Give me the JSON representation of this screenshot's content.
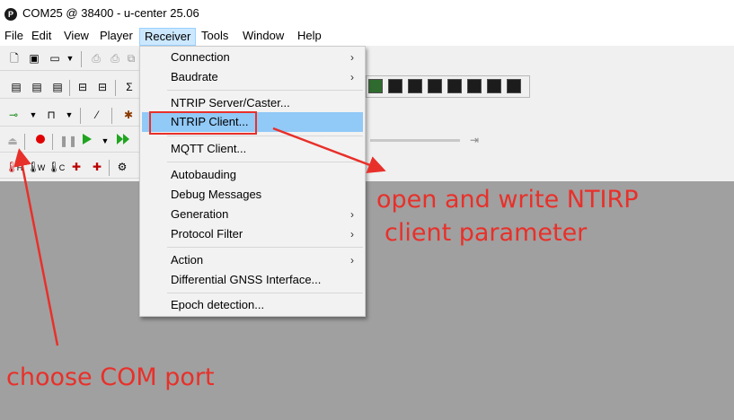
{
  "window": {
    "title": "COM25 @ 38400 - u-center 25.06",
    "logo_letter": "P"
  },
  "menubar": {
    "items": [
      "File",
      "Edit",
      "View",
      "Player",
      "Receiver",
      "Tools",
      "Window",
      "Help"
    ],
    "open_item": "Receiver"
  },
  "receiver_menu": {
    "connection": "Connection",
    "baudrate": "Baudrate",
    "ntrip_server": "NTRIP Server/Caster...",
    "ntrip_client": "NTRIP Client...",
    "mqtt_client": "MQTT Client...",
    "autobauding": "Autobauding",
    "debug_messages": "Debug Messages",
    "generation": "Generation",
    "protocol_filter": "Protocol Filter",
    "action": "Action",
    "differential_gnss": "Differential GNSS Interface...",
    "epoch_detection": "Epoch detection...",
    "submenu_arrow": "›",
    "highlighted_item": "NTRIP Client..."
  },
  "toolbar": {
    "row3_labels": {
      "h": "H",
      "w": "W",
      "c": "C"
    },
    "rec_color": "#e00000",
    "play_color": "#1fa51f",
    "icons": [
      "new-file-icon",
      "save-icon",
      "open-folder-icon",
      "print-icon",
      "print-preview-icon",
      "copy-icon",
      "docking-icon",
      "console-icon",
      "connect-icon",
      "baud-icon",
      "wand-icon",
      "bug-icon",
      "eject-icon",
      "record-icon",
      "pause-icon",
      "play-icon",
      "fast-forward-icon",
      "skip-end-icon",
      "thermometer-icon"
    ]
  },
  "annotations": {
    "arrow_color": "#e8302a",
    "right_text_line1": "open and write NTIRP",
    "right_text_line2": "client parameter",
    "bottom_text": "choose COM port"
  }
}
